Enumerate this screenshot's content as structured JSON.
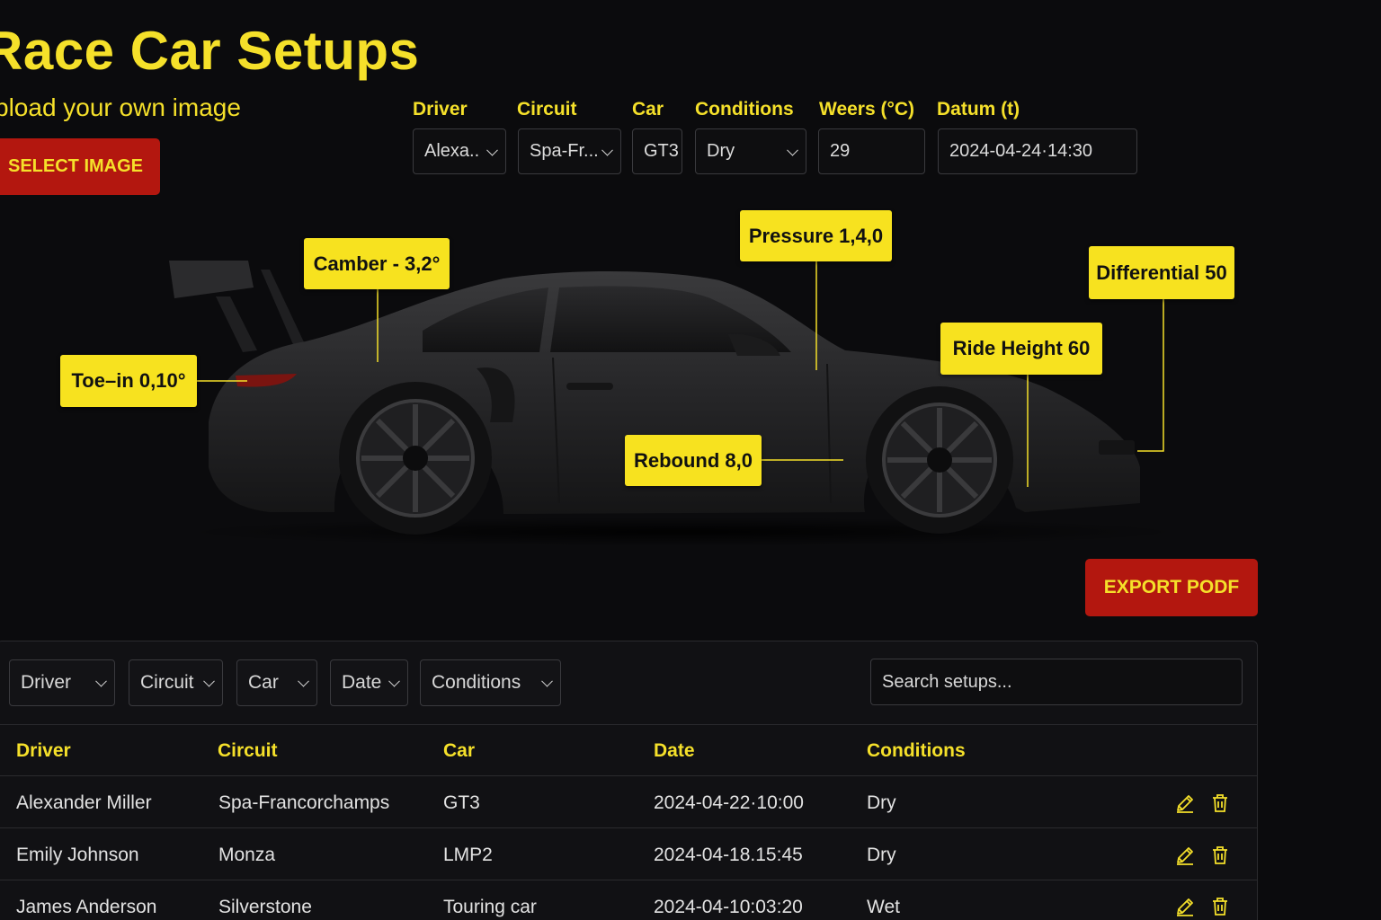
{
  "header": {
    "title": "Race Car Setups",
    "upload_text": "pload your own image",
    "select_button": "SELECT IMAGE"
  },
  "fields": [
    {
      "label": "Driver",
      "value": "Alexa..",
      "type": "select"
    },
    {
      "label": "Circuit",
      "value": "Spa-Fr...",
      "type": "select"
    },
    {
      "label": "Car",
      "value": "GT3",
      "type": "text"
    },
    {
      "label": "Conditions",
      "value": "Dry",
      "type": "select"
    },
    {
      "label": "Weers (°C)",
      "value": "29",
      "type": "text"
    },
    {
      "label": "Datum (t)",
      "value": "2024-04-24·14:30",
      "type": "text"
    }
  ],
  "callouts": {
    "camber": "Camber - 3,2°",
    "pressure": "Pressure 1,4,0",
    "differential": "Differential 50",
    "toe_in": "Toe–in 0,10°",
    "ride_height": "Ride Height 60",
    "rebound": "Rebound 8,0"
  },
  "export_button": "EXPORT PODF",
  "filters": [
    "Driver",
    "Circuit",
    "Car",
    "Date",
    "Conditions"
  ],
  "search": {
    "placeholder": "Search setups..."
  },
  "table": {
    "headers": [
      "Driver",
      "Circuit",
      "Car",
      "Date",
      "Conditions"
    ],
    "rows": [
      {
        "driver": "Alexander Miller",
        "circuit": "Spa-Francorchamps",
        "car": "GT3",
        "date": "2024-04-22·10:00",
        "conditions": "Dry"
      },
      {
        "driver": "Emily Johnson",
        "circuit": "Monza",
        "car": "LMP2",
        "date": "2024-04-18.15:45",
        "conditions": "Dry"
      },
      {
        "driver": "James Anderson",
        "circuit": "Silverstone",
        "car": "Touring car",
        "date": "2024-04-10:03:20",
        "conditions": "Wet"
      }
    ]
  },
  "colors": {
    "accent": "#f5e02a",
    "button": "#b3170f",
    "background": "#0b0b0d"
  }
}
